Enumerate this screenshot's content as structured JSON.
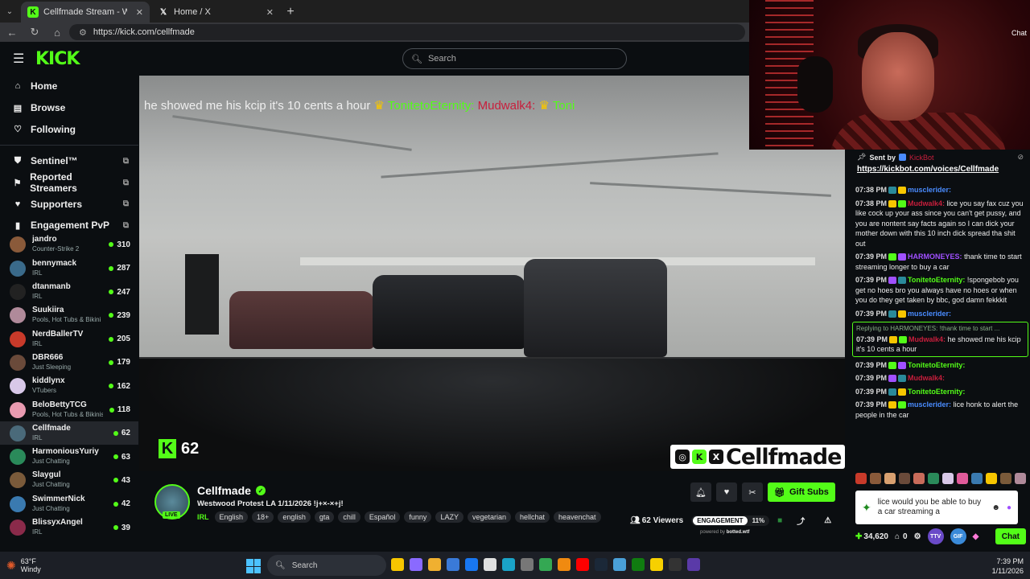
{
  "browser": {
    "tabs": [
      {
        "title": "Cellfmade Stream - Watch Liv",
        "active": true
      },
      {
        "title": "Home / X",
        "active": false
      }
    ],
    "url": "https://kick.com/cellfmade"
  },
  "header": {
    "logo": "KICK",
    "search_placeholder": "Search"
  },
  "sidebar": {
    "nav": [
      {
        "label": "Home",
        "icon": "home-icon"
      },
      {
        "label": "Browse",
        "icon": "browse-icon"
      },
      {
        "label": "Following",
        "icon": "heart-icon"
      }
    ],
    "tools": [
      {
        "label": "Sentinel™",
        "icon": "shield-icon"
      },
      {
        "label": "Reported Streamers",
        "icon": "flag-icon"
      },
      {
        "label": "Supporters",
        "icon": "heart-icon"
      },
      {
        "label": "Engagement PvP",
        "icon": "chart-icon"
      }
    ],
    "channels": [
      {
        "name": "jandro",
        "category": "Counter-Strike 2",
        "viewers": "310",
        "color": "#8a5a3a"
      },
      {
        "name": "bennymack",
        "category": "IRL",
        "viewers": "287",
        "color": "#3a6a8a"
      },
      {
        "name": "dtanmanb",
        "category": "IRL",
        "viewers": "247",
        "color": "#222"
      },
      {
        "name": "Suukiira",
        "category": "Pools, Hot Tubs & Bikini",
        "viewers": "239",
        "color": "#b08a9a"
      },
      {
        "name": "NerdBallerTV",
        "category": "IRL",
        "viewers": "205",
        "color": "#c83a2a"
      },
      {
        "name": "DBR666",
        "category": "Just Sleeping",
        "viewers": "179",
        "color": "#6a4a3a"
      },
      {
        "name": "kiddlynx",
        "category": "VTubers",
        "viewers": "162",
        "color": "#d8c8e8"
      },
      {
        "name": "BeloBettyTCG",
        "category": "Pools, Hot Tubs & Bikinis",
        "viewers": "118",
        "color": "#e89ab0"
      },
      {
        "name": "Cellfmade",
        "category": "IRL",
        "viewers": "62",
        "color": "#4a6a7a",
        "selected": true
      },
      {
        "name": "HarmoniousYuriy",
        "category": "Just Chatting",
        "viewers": "63",
        "color": "#2a8a5a"
      },
      {
        "name": "Slaygul",
        "category": "Just Chatting",
        "viewers": "43",
        "color": "#7a5a3a"
      },
      {
        "name": "SwimmerNick",
        "category": "Just Chatting",
        "viewers": "42",
        "color": "#3a7ab0"
      },
      {
        "name": "BlissyxAngel",
        "category": "IRL",
        "viewers": "39",
        "color": "#8a2a4a"
      }
    ]
  },
  "video": {
    "ticker": {
      "text": "he showed me his kcip it's 10 cents a hour",
      "user1": "TonitetoEternity:",
      "user2": "Mudwalk4:",
      "user3": "Toni"
    },
    "viewer_overlay": "62",
    "brand_overlay": "Cellfmade"
  },
  "webcam": {
    "label": "Chat"
  },
  "chat": {
    "pinned": {
      "sent_by": "Sent by",
      "user": "KickBot",
      "link": "https://kickbot.com/voices/Cellfmade"
    },
    "messages": [
      {
        "time": "07:38 PM",
        "user": "musclerider:",
        "color": "#4a8cff",
        "text": ""
      },
      {
        "time": "07:38 PM",
        "user": "Mudwalk4:",
        "color": "#c81e3c",
        "text": "lice you say fax cuz you like cock up your ass since you can't get pussy, and you are nontent say facts again so I can dick your mother down with this 10 inch dick spread tha shit out"
      },
      {
        "time": "07:39 PM",
        "user": "HARMONEYES:",
        "color": "#a050ff",
        "text": "thank time to start streaming longer to buy a car"
      },
      {
        "time": "07:39 PM",
        "user": "TonitetoEternity:",
        "color": "#53fc18",
        "text": "!spongebob you get no hoes bro you always have no hoes or when you do they get taken by bbc, god damn fekkkit"
      },
      {
        "time": "07:39 PM",
        "user": "musclerider:",
        "color": "#4a8cff",
        "text": ""
      },
      {
        "time": "07:39 PM",
        "user": "Mudwalk4:",
        "color": "#c81e3c",
        "text": "he showed me his kcip it's 10 cents a hour",
        "reply_to": "Replying to HARMONEYES: !thank time to start ..."
      },
      {
        "time": "07:39 PM",
        "user": "TonitetoEternity:",
        "color": "#53fc18",
        "text": ""
      },
      {
        "time": "07:39 PM",
        "user": "Mudwalk4:",
        "color": "#c81e3c",
        "text": ""
      },
      {
        "time": "07:39 PM",
        "user": "TonitetoEternity:",
        "color": "#53fc18",
        "text": ""
      },
      {
        "time": "07:39 PM",
        "user": "musclerider:",
        "color": "#4a8cff",
        "text": "lice honk to alert the people in the car"
      }
    ],
    "input_text": "lice would you be able to buy a car streaming a",
    "points": "34,620",
    "count": "0",
    "pill1": "TTV",
    "pill2": "GIF",
    "send_label": "Chat"
  },
  "stream_info": {
    "streamer": "Cellfmade",
    "live_badge": "LIVE",
    "title": "Westwood Protest LA 1/11/2026 !j+×-×+j!",
    "category": "IRL",
    "tags": [
      "English",
      "18+",
      "english",
      "gta",
      "chill",
      "Español",
      "funny",
      "LAZY",
      "vegetarian",
      "hellchat",
      "heavenchat"
    ],
    "gift_label": "Gift Subs",
    "viewers": "62 Viewers",
    "engagement_label": "ENGAGEMENT",
    "engagement_value": "11%",
    "powered_by": "powered by",
    "powered_brand": "botted.wtf"
  },
  "taskbar": {
    "temp": "63°F",
    "weather": "Windy",
    "search": "Search",
    "time": "7:39 PM",
    "date": "1/11/2026"
  }
}
